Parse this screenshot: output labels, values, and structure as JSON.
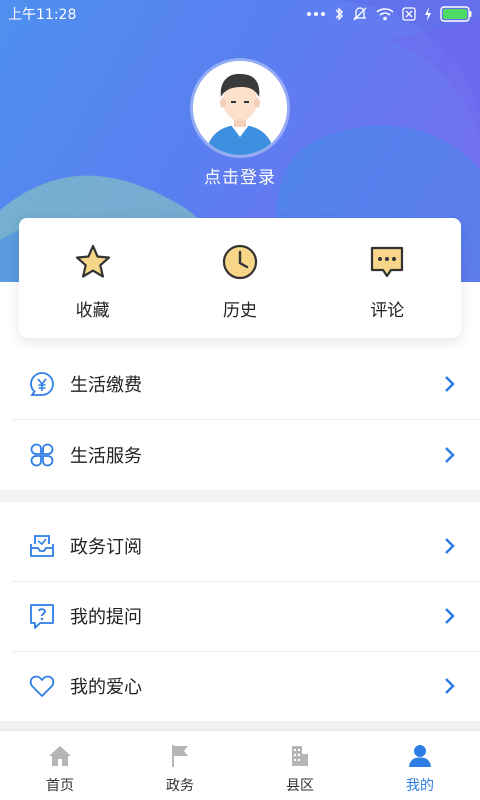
{
  "status_bar": {
    "time": "上午11:28",
    "icons": [
      "more-dots-icon",
      "bluetooth-icon",
      "mute-icon",
      "wifi-icon",
      "sim-icon",
      "charging-icon",
      "battery-icon"
    ]
  },
  "profile": {
    "login_label": "点击登录"
  },
  "actions": [
    {
      "label": "收藏",
      "icon": "star-icon"
    },
    {
      "label": "历史",
      "icon": "clock-icon"
    },
    {
      "label": "评论",
      "icon": "comment-icon"
    }
  ],
  "menu_group_1": [
    {
      "label": "生活缴费",
      "icon": "yuan-payment-icon"
    },
    {
      "label": "生活服务",
      "icon": "clover-service-icon"
    }
  ],
  "menu_group_2": [
    {
      "label": "政务订阅",
      "icon": "inbox-subscribe-icon"
    },
    {
      "label": "我的提问",
      "icon": "question-bubble-icon"
    },
    {
      "label": "我的爱心",
      "icon": "heart-icon"
    }
  ],
  "bottom_nav": [
    {
      "label": "首页",
      "icon": "home-icon",
      "active": false
    },
    {
      "label": "政务",
      "icon": "flag-icon",
      "active": false
    },
    {
      "label": "县区",
      "icon": "building-icon",
      "active": false
    },
    {
      "label": "我的",
      "icon": "user-icon",
      "active": true
    }
  ],
  "colors": {
    "accent": "#2f7ee6",
    "hero_start": "#4f8ff0",
    "hero_end": "#7a6ff0",
    "icon_gold": "#f7d68a",
    "divider": "#ececec",
    "inactive_icon": "#b5b5b5"
  }
}
